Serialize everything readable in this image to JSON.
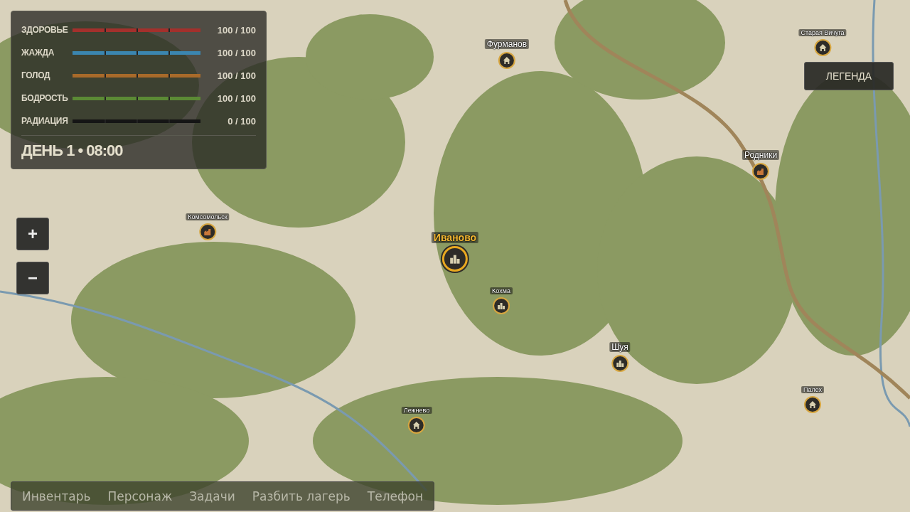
{
  "stats": [
    {
      "label": "ЗДОРОВЬЕ",
      "level": 1,
      "value": "100 / 100",
      "color": "#a3302c"
    },
    {
      "label": "ЖАЖДА",
      "level": 1,
      "value": "100 / 100",
      "color": "#3b86b0"
    },
    {
      "label": "ГОЛОД",
      "level": 1,
      "value": "100 / 100",
      "color": "#a86a2a"
    },
    {
      "label": "БОДРОСТЬ",
      "level": 1,
      "value": "100 / 100",
      "color": "#5b8a35"
    },
    {
      "label": "РАДИАЦИЯ",
      "level": 0,
      "value": "0 / 100"
    }
  ],
  "clock": "ДЕНЬ 1 • 08:00",
  "zoom_buttons": [
    "+",
    "−"
  ],
  "legend_button": "ЛЕГЕНДА",
  "markers": [
    {
      "name": "Фурманов",
      "kind": "house",
      "major": true,
      "selected": false
    },
    {
      "name": "Старая Вичуга",
      "kind": "house",
      "major": false,
      "selected": false
    },
    {
      "name": "Родники",
      "kind": "factory",
      "major": true,
      "selected": false
    },
    {
      "name": "Комсомольск",
      "kind": "factory",
      "major": false,
      "selected": false
    },
    {
      "name": "Иваново",
      "kind": "city",
      "major": true,
      "selected": true
    },
    {
      "name": "Кохма",
      "kind": "city",
      "major": false,
      "selected": false
    },
    {
      "name": "Шуя",
      "kind": "city",
      "major": true,
      "selected": false
    },
    {
      "name": "Лежнево",
      "kind": "house",
      "major": false,
      "selected": false
    },
    {
      "name": "Палех",
      "kind": "house",
      "major": false,
      "selected": false
    }
  ],
  "menu": [
    "Инвентарь",
    "Персонаж",
    "Задачи",
    "Разбить лагерь",
    "Телефон"
  ]
}
